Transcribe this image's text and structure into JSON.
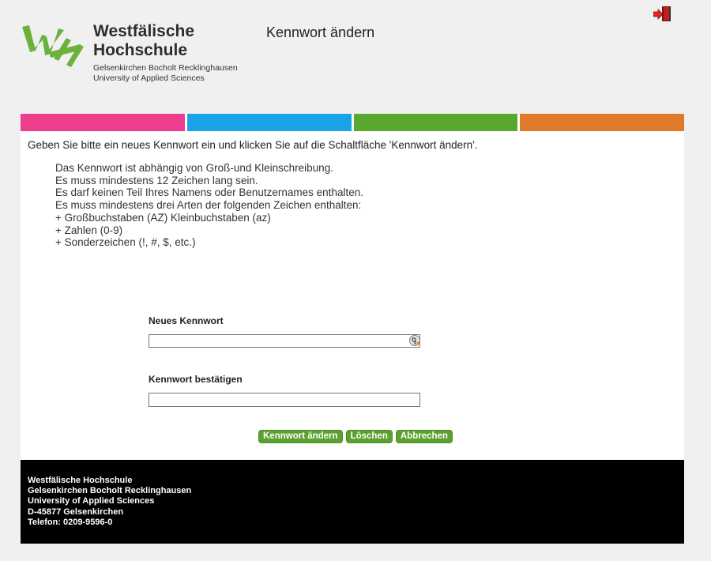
{
  "header": {
    "logo": {
      "name_line1": "Westfälische",
      "name_line2": "Hochschule",
      "sub_line1": "Gelsenkirchen Bocholt Recklinghausen",
      "sub_line2": "University of Applied Sciences",
      "mark_color": "#6ab23e"
    },
    "page_title": "Kennwort ändern",
    "logout_icon": "logout-door-arrow-icon"
  },
  "colorbar": [
    "#ee3e8e",
    "#1ba3e8",
    "#5aa72f",
    "#e07a2b"
  ],
  "instructions": {
    "intro": "Geben Sie bitte ein neues Kennwort ein und klicken Sie auf die Schaltfläche 'Kennwort ändern'.",
    "rules": [
      "Das Kennwort ist abhängig von Groß-und Kleinschreibung.",
      "Es muss mindestens 12 Zeichen lang sein.",
      "Es darf keinen Teil Ihres Namens oder Benutzernames enthalten.",
      "Es muss mindestens drei Arten der folgenden Zeichen enthalten:",
      "+ Großbuchstaben (AZ) Kleinbuchstaben (az)",
      "+ Zahlen (0-9)",
      "+ Sonderzeichen (!, #, $, etc.)"
    ]
  },
  "form": {
    "new_password": {
      "label": "Neues Kennwort",
      "value": "",
      "icon": "password-manager-key-icon"
    },
    "confirm_password": {
      "label": "Kennwort bestätigen",
      "value": ""
    }
  },
  "buttons": {
    "change": "Kennwort ändern",
    "clear": "Löschen",
    "cancel": "Abbrechen",
    "color": "#5aa12d"
  },
  "footer": {
    "lines": [
      "Westfälische Hochschule",
      "Gelsenkirchen Bocholt Recklinghausen",
      "University of Applied Sciences",
      "D-45877 Gelsenkirchen",
      "Telefon: 0209-9596-0"
    ]
  }
}
